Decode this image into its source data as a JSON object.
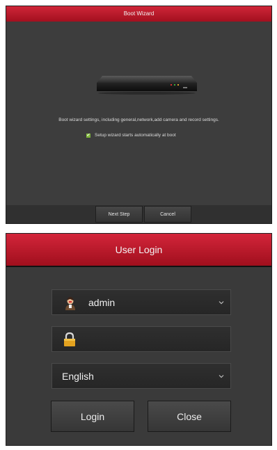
{
  "boot_wizard": {
    "title": "Boot Wizard",
    "description": "Boot wizard settings, including general,network,add camera and record settings.",
    "auto_start_label": "Setup wizard starts automatically at boot",
    "auto_start_checked": true,
    "next_label": "Next Step",
    "cancel_label": "Cancel"
  },
  "user_login": {
    "title": "User Login",
    "username": "admin",
    "password": "",
    "language": "English",
    "login_label": "Login",
    "close_label": "Close"
  },
  "colors": {
    "header_red": "#c0182c",
    "panel_dark": "#3a3a3a",
    "checkbox_green": "#7fb63a",
    "lock_gold": "#e3a21f"
  }
}
